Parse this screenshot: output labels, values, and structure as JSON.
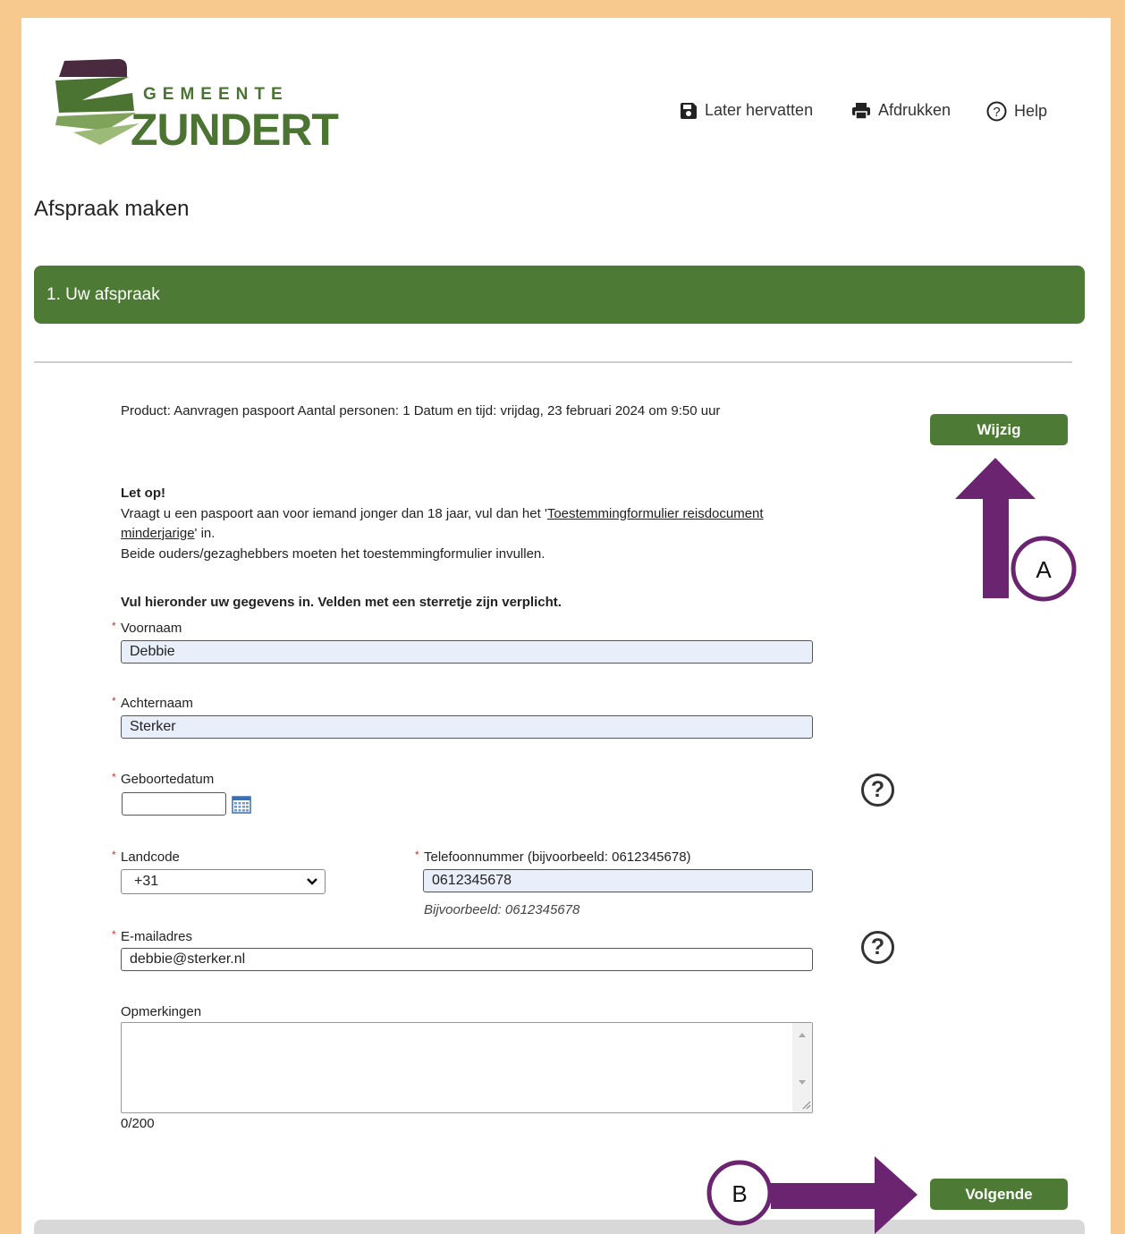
{
  "header": {
    "logo_small": "GEMEENTE",
    "logo_big": "ZUNDERT",
    "links": {
      "later": "Later hervatten",
      "print": "Afdrukken",
      "help": "Help"
    }
  },
  "page": {
    "title": "Afspraak maken",
    "step_label": "1. Uw afspraak"
  },
  "summary": {
    "text": "Product: Aanvragen paspoort Aantal personen: 1 Datum en tijd: vrijdag, 23 februari 2024 om 9:50 uur",
    "change_button": "Wijzig"
  },
  "notice": {
    "heading": "Let op!",
    "line1_prefix": "Vraagt u een paspoort aan voor iemand jonger dan 18 jaar, vul dan het '",
    "link_text": "Toestemmingformulier reisdocument minderjarige",
    "line1_suffix": "' in.",
    "line2": "Beide ouders/gezaghebbers moeten het toestemmingformulier invullen."
  },
  "form": {
    "instructions": "Vul hieronder uw gegevens in. Velden met een sterretje zijn verplicht.",
    "required_mark": "*",
    "first_name": {
      "label": "Voornaam",
      "value": "Debbie"
    },
    "last_name": {
      "label": "Achternaam",
      "value": "Sterker"
    },
    "birth_date": {
      "label": "Geboortedatum",
      "value": ""
    },
    "country_code": {
      "label": "Landcode",
      "value": "+31"
    },
    "phone": {
      "label": "Telefoonnummer (bijvoorbeeld: 0612345678)",
      "value": "0612345678",
      "hint": "Bijvoorbeeld: 0612345678"
    },
    "email": {
      "label": "E-mailadres",
      "value": "debbie@sterker.nl"
    },
    "remarks": {
      "label": "Opmerkingen",
      "value": "",
      "counter": "0/200"
    },
    "help_glyph": "?",
    "next_button": "Volgende"
  },
  "annotations": {
    "a": "A",
    "b": "B",
    "color": "#6b2470"
  },
  "colors": {
    "frame": "#f7c98e",
    "brand_green": "#4d7a34",
    "logo_purple": "#4a2a3e",
    "input_fill": "#e8effb"
  }
}
